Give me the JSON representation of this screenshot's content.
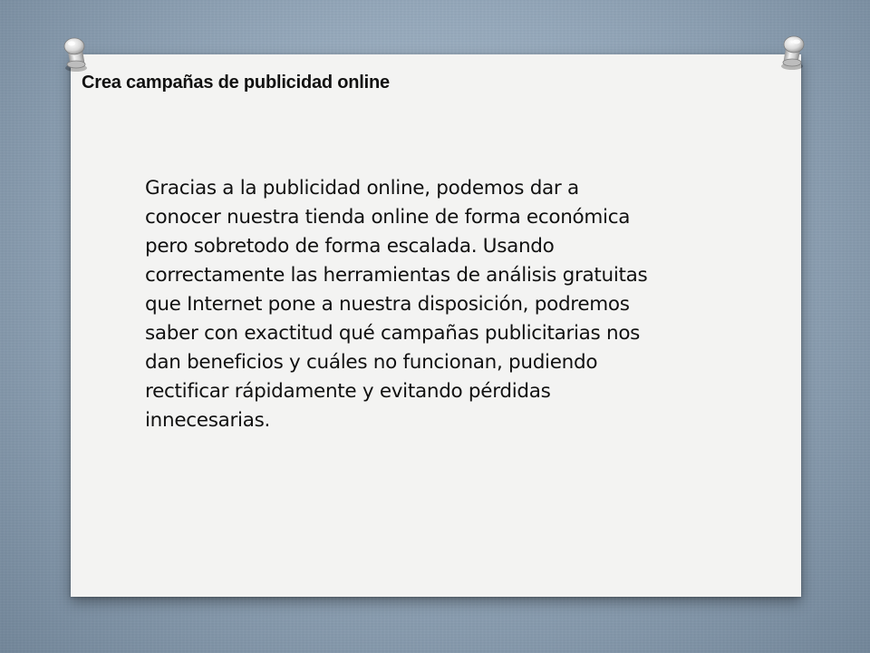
{
  "slide": {
    "title": "Crea campañas de publicidad online",
    "body": "Gracias a la publicidad online, podemos dar a conocer nuestra tienda online de forma económica pero sobretodo de forma escalada. Usando correctamente las herramientas de análisis gratuitas que Internet pone a nuestra disposición, podremos saber con exactitud qué campañas publicitarias nos dan beneficios y cuáles no funcionan, pudiendo rectificar rápidamente y evitando pérdidas innecesarias."
  },
  "theme": {
    "background": "#8fa3b6",
    "paper": "#f3f3f2",
    "text": "#111111"
  },
  "icons": {
    "left_pin": "pushpin-icon",
    "right_pin": "pushpin-icon"
  }
}
